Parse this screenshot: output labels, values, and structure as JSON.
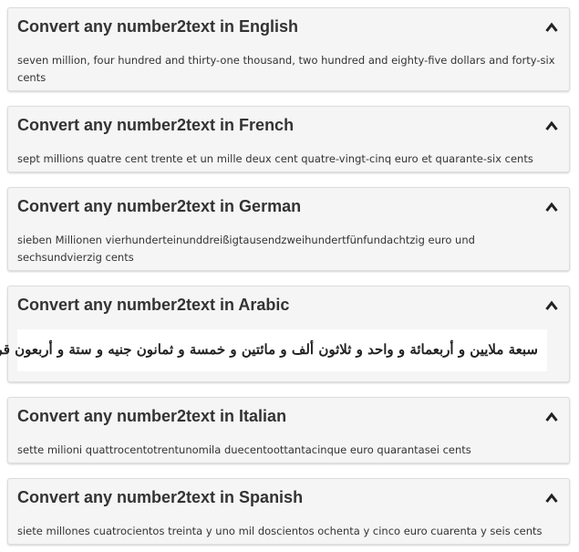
{
  "panels": [
    {
      "title": "Convert any number2text in English",
      "text": "seven million, four hundred and thirty-one thousand, two hundred and eighty-five dollars and forty-six cents"
    },
    {
      "title": "Convert any number2text in French",
      "text": "sept millions quatre cent trente et un mille deux cent quatre-vingt-cinq euro et quarante-six cents"
    },
    {
      "title": "Convert any number2text in German",
      "text": "sieben Millionen vierhunderteinunddreißigtausendzweihundertfünfundachtzig euro und sechsundvierzig cents"
    },
    {
      "title": "Convert any number2text in Arabic",
      "text": "سبعة ملايين و أربعمائة و واحد و ثلاثون ألف و مائتين و خمسة و ثمانون جنيه و ستة و أربعون قرش"
    },
    {
      "title": "Convert any number2text in Italian",
      "text": "sette milioni quattrocentotrentunomila duecentoottantacinque euro quarantasei cents"
    },
    {
      "title": "Convert any number2text in Spanish",
      "text": "siete millones cuatrocientos treinta y uno mil doscientos ochenta y cinco euro cuarenta y seis cents"
    }
  ],
  "icons": {
    "collapse": "chevron-up-icon"
  },
  "colors": {
    "panel_background": "#f5f5f5",
    "panel_border": "#dddddd",
    "text": "#333333",
    "arabic_background": "#ffffff"
  }
}
